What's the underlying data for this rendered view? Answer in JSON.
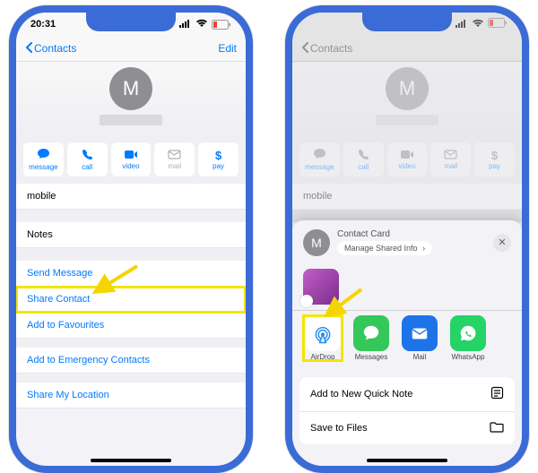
{
  "status": {
    "time": "20:31"
  },
  "nav": {
    "back": "Contacts",
    "edit": "Edit"
  },
  "avatar_initial": "M",
  "actions": {
    "message": "message",
    "call": "call",
    "video": "video",
    "mail": "mail",
    "pay": "pay"
  },
  "fields": {
    "mobile": "mobile",
    "notes": "Notes"
  },
  "links": {
    "send_message": "Send Message",
    "share_contact": "Share Contact",
    "add_favourites": "Add to Favourites",
    "add_emergency": "Add to Emergency Contacts",
    "share_location": "Share My Location"
  },
  "sheet": {
    "title": "Contact Card",
    "manage": "Manage Shared Info",
    "apps": {
      "airdrop": "AirDrop",
      "messages": "Messages",
      "mail": "Mail",
      "whatsapp": "WhatsApp"
    },
    "quick_note": "Add to New Quick Note",
    "save_files": "Save to Files"
  }
}
